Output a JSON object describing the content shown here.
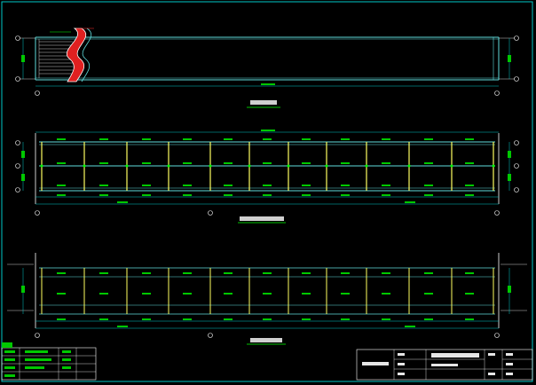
{
  "colors": {
    "background": "#000000",
    "frame": "#00c8c8",
    "truss_line": "#5fdcdc",
    "post": "#ffff60",
    "node": "#00ff00",
    "label_text": "#00ff00",
    "title_text": "#ffffff",
    "axis_bubble": "#ffffff",
    "stair_red": "#e02020",
    "stair_border": "#ffffff"
  },
  "views": [
    {
      "id": "plan",
      "caption": ""
    },
    {
      "id": "truss-elevation",
      "caption": ""
    },
    {
      "id": "truss-section",
      "caption": ""
    }
  ],
  "title_block": {
    "project": "",
    "drawing_name": "",
    "drawing_number": ""
  },
  "legend": {
    "rows": [
      {
        "label": "",
        "swatch": "#00c800"
      },
      {
        "label": "",
        "swatch": "#00c800"
      },
      {
        "label": "",
        "swatch": "#00c800"
      }
    ]
  },
  "icons": {
    "axis_bubble": "circle-axis-icon",
    "stair": "stair-icon"
  }
}
